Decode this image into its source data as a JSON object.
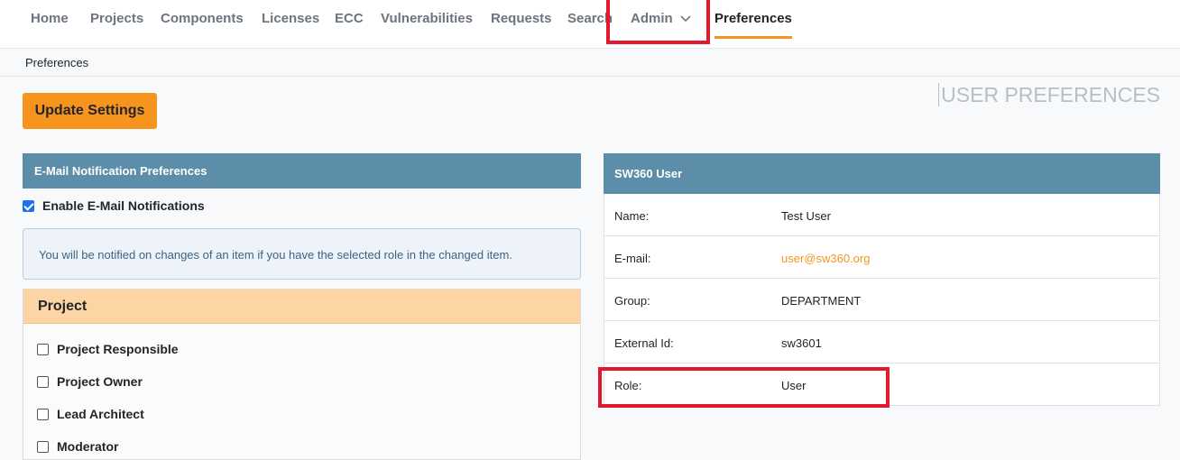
{
  "nav": {
    "items": [
      "Home",
      "Projects",
      "Components",
      "Licenses",
      "ECC",
      "Vulnerabilities",
      "Requests",
      "Search"
    ],
    "admin_label": "Admin",
    "active_label": "Preferences"
  },
  "breadcrumb": "Preferences",
  "actions": {
    "update_label": "Update Settings"
  },
  "page_heading": "USER PREFERENCES",
  "email_prefs": {
    "title": "E-Mail Notification Preferences",
    "enable_label": "Enable E-Mail Notifications",
    "enable_checked": true,
    "info": "You will be notified on changes of an item if you have the selected role in the changed item.",
    "project_title": "Project",
    "project_roles": [
      "Project Responsible",
      "Project Owner",
      "Lead Architect",
      "Moderator"
    ]
  },
  "user_panel": {
    "title": "SW360 User",
    "rows": [
      {
        "key": "Name:",
        "value": "Test User"
      },
      {
        "key": "E-mail:",
        "value": "user@sw360.org"
      },
      {
        "key": "Group:",
        "value": "DEPARTMENT"
      },
      {
        "key": "External Id:",
        "value": "sw3601"
      },
      {
        "key": "Role:",
        "value": "User"
      }
    ]
  },
  "colors": {
    "accent": "#f7941e",
    "panel_header": "#5d8ea9",
    "highlight": "#e3182d"
  }
}
